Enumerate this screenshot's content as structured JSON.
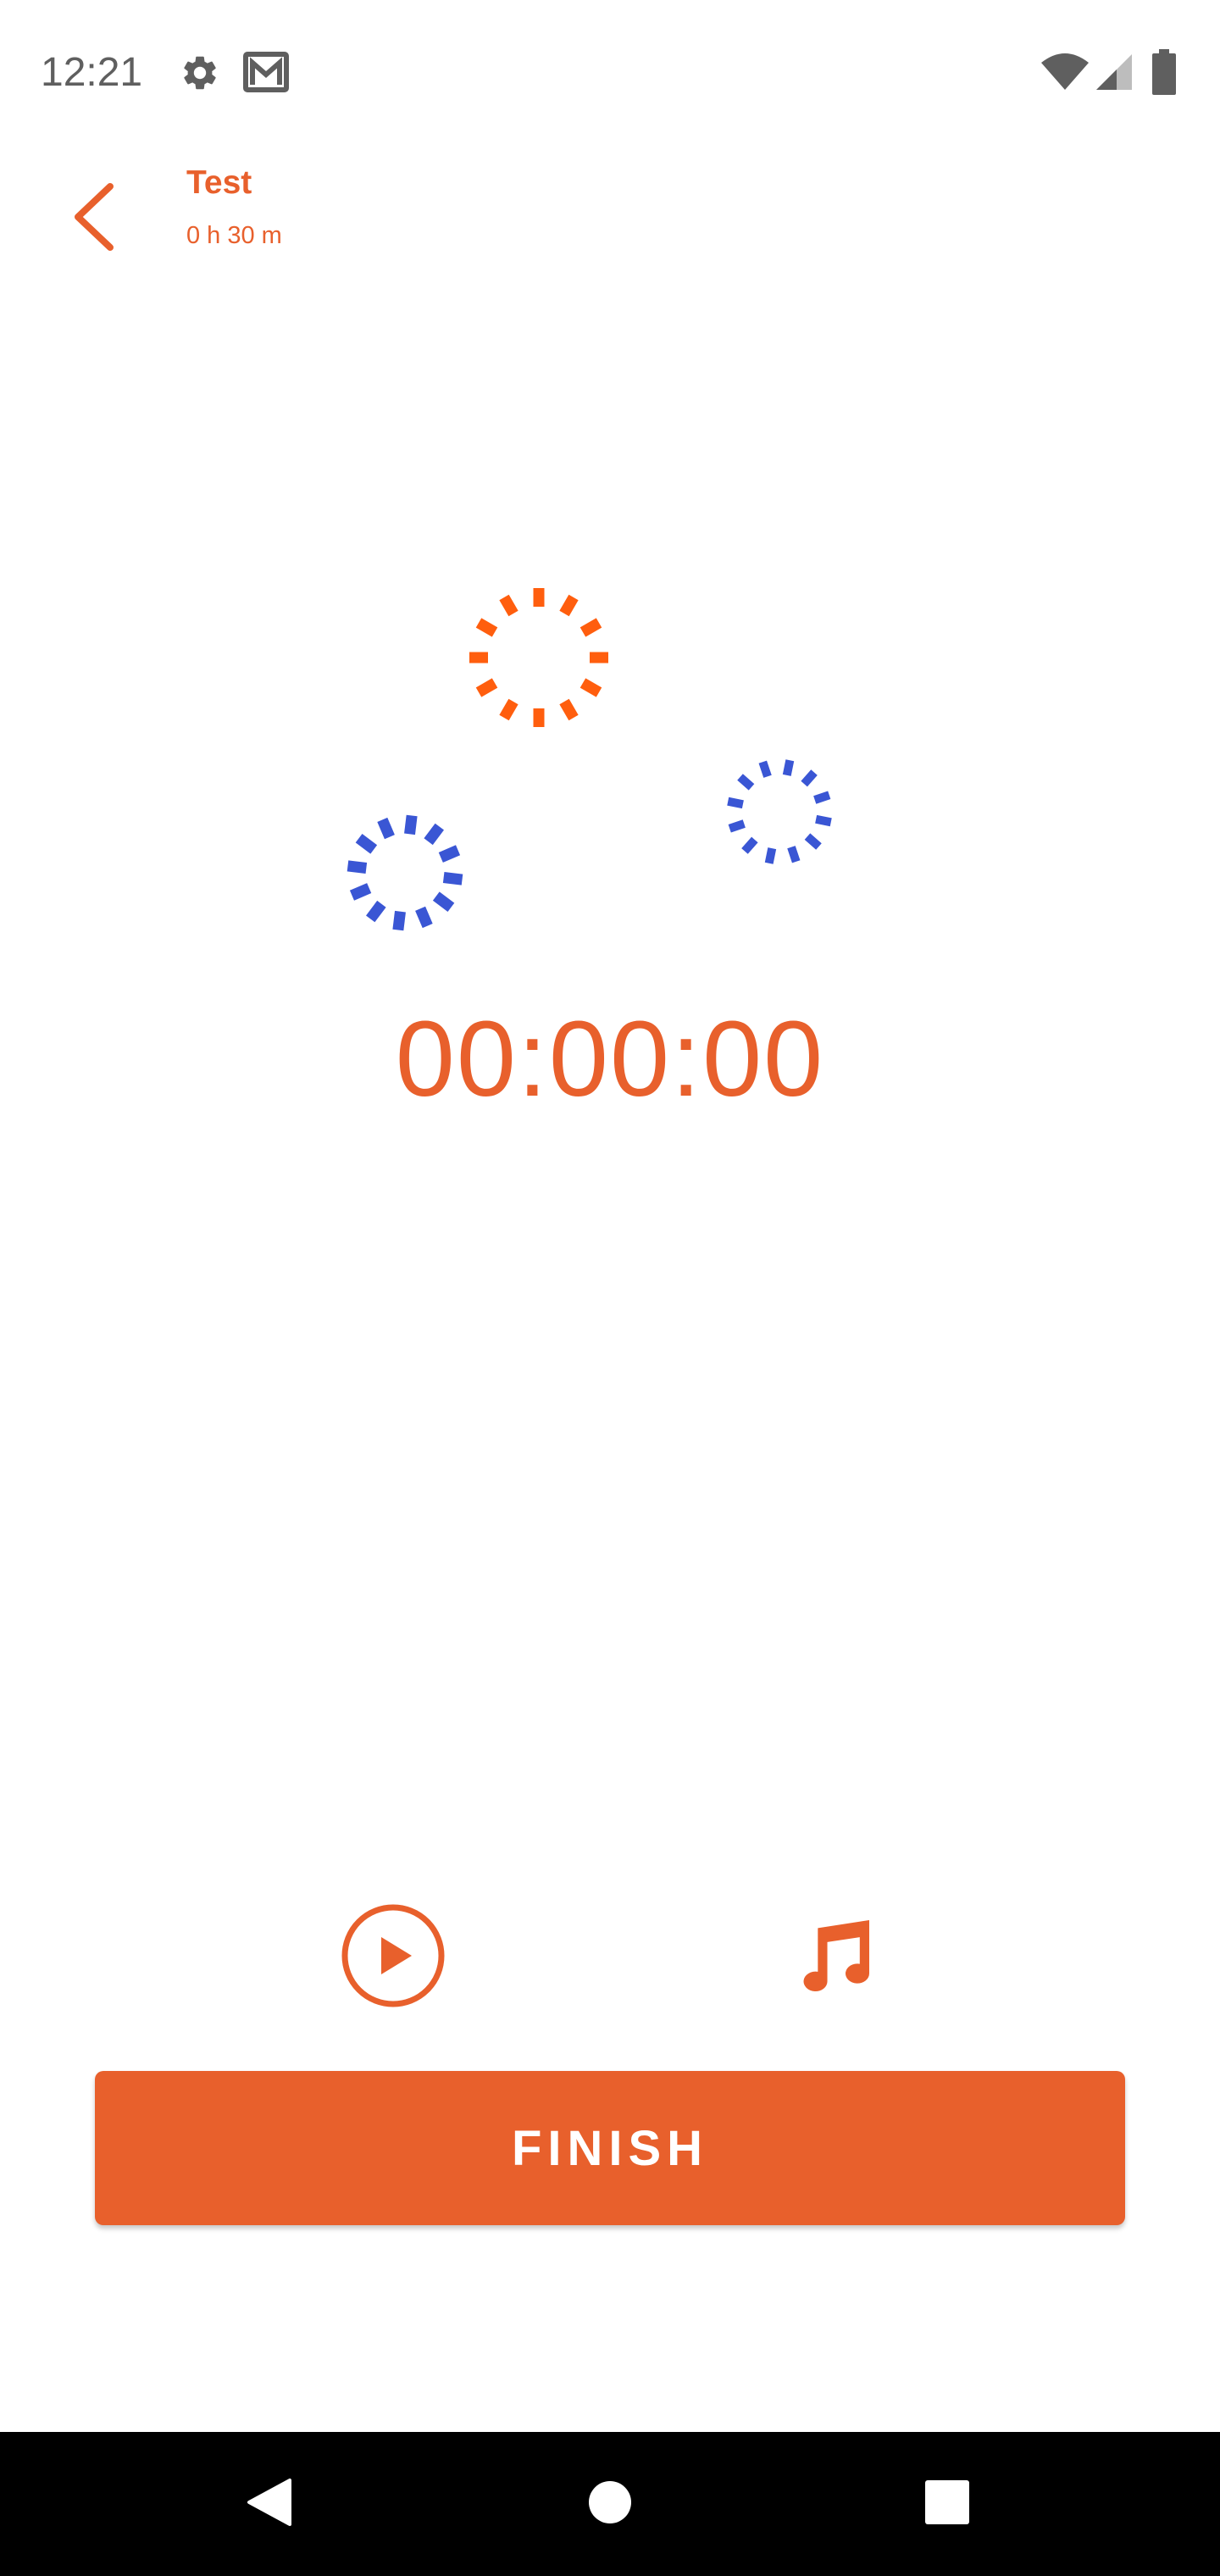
{
  "status_bar": {
    "time": "12:21",
    "icons": [
      "settings-icon",
      "gmail-icon",
      "wifi-icon",
      "cell-signal-icon",
      "battery-icon"
    ]
  },
  "header": {
    "title": "Test",
    "subtitle": "0 h 30 m",
    "back_icon": "chevron-left-icon"
  },
  "timer": {
    "value": "00:00:00"
  },
  "controls": {
    "play_icon": "play-circle-icon",
    "music_icon": "music-note-icon"
  },
  "finish_button": {
    "label": "FINISH"
  },
  "nav_bar": {
    "icons": [
      "back-triangle-icon",
      "home-circle-icon",
      "recents-square-icon"
    ]
  },
  "colors": {
    "accent": "#e8602c",
    "spinner_orange": "#ff5e0e",
    "spinner_blue": "#3a56d4",
    "status_gray": "#5f5f5f",
    "nav_background": "#000000"
  }
}
